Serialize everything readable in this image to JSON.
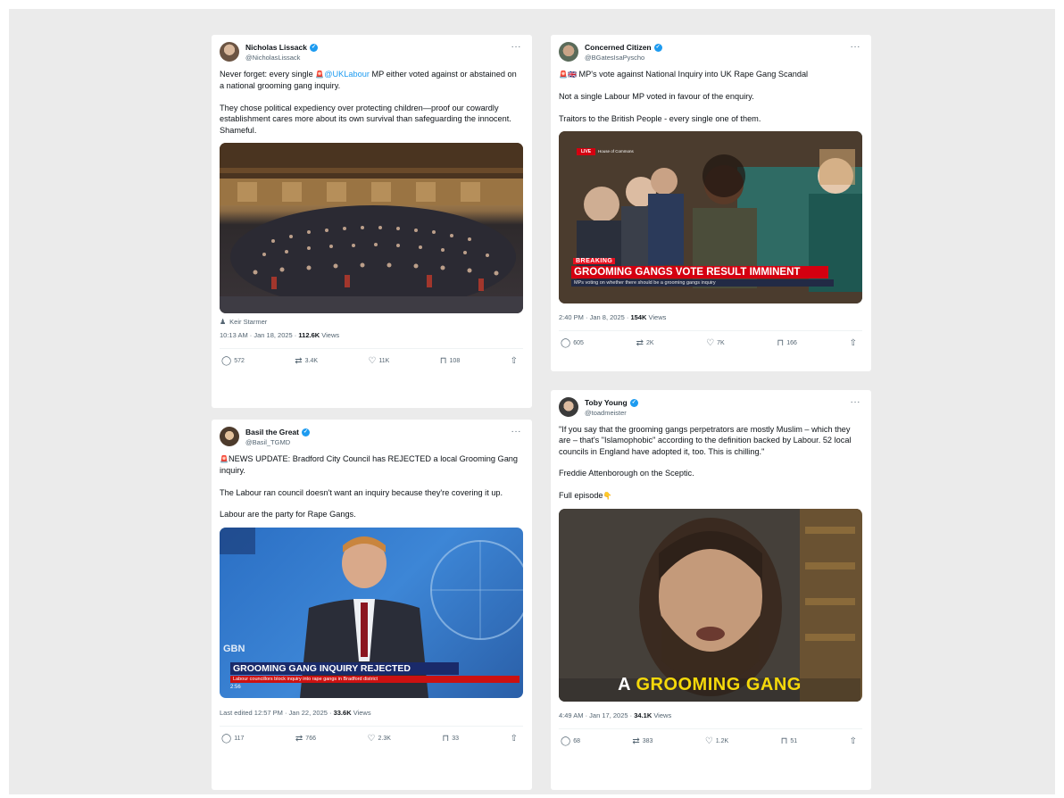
{
  "tweets": [
    {
      "name": "Nicholas Lissack",
      "handle": "@NicholasLissack",
      "body_parts": [
        "Never forget: every single ",
        "@UKLabour",
        " MP either voted against or abstained on a national grooming gang inquiry."
      ],
      "body2": "They chose political expediency over protecting children—proof our cowardly establishment cares more about its own survival than safeguarding the innocent. Shameful.",
      "attribution": "Keir Starmer",
      "time": "10:13 AM · Jan 18, 2025 · ",
      "views": "112.6K",
      "views_label": " Views",
      "replies": "572",
      "reposts": "3.4K",
      "likes": "11K",
      "bookmarks": "108"
    },
    {
      "name": "Concerned Citizen",
      "handle": "@BGatesIsaPyscho",
      "line1": "MP's vote against National Inquiry into UK Rape Gang Scandal",
      "line2": "Not a single Labour MP voted in favour of the enquiry.",
      "line3": "Traitors to the British People - every single one of them.",
      "banner_tag": "BREAKING",
      "banner_title": "GROOMING GANGS VOTE RESULT IMMINENT",
      "banner_sub": "MPs voting on whether there should be a grooming gangs inquiry",
      "live": "LIVE",
      "house": "House of Commons",
      "time": "2:40 PM · Jan 8, 2025 · ",
      "views": "154K",
      "views_label": " Views",
      "replies": "605",
      "reposts": "2K",
      "likes": "7K",
      "bookmarks": "166"
    },
    {
      "name": "Basil the Great",
      "handle": "@Basil_TGMD",
      "line1": "NEWS UPDATE: Bradford City Council has REJECTED  a local Grooming Gang inquiry.",
      "line2": "The Labour ran council doesn't want an inquiry because they're covering it up.",
      "line3": "Labour are the party for Rape Gangs.",
      "channel": "GBN",
      "banner_title": "GROOMING GANG INQUIRY REJECTED",
      "banner_sub": "Labour councillors block inquiry into rape gangs in Bradford district",
      "clock": "2:56",
      "time": "Last edited 12:57 PM · Jan 22, 2025 · ",
      "views": "33.6K",
      "views_label": " Views",
      "replies": "117",
      "reposts": "766",
      "likes": "2.3K",
      "bookmarks": "33"
    },
    {
      "name": "Toby Young",
      "handle": "@toadmeister",
      "line1": "\"If you say that the grooming gangs perpetrators are mostly Muslim – which they are – that's \"Islamophobic\" according to the definition backed by Labour. 52 local councils in England have adopted it, too. This is chilling.\"",
      "line2": "Freddie Attenborough on the Sceptic.",
      "line3": "Full episode",
      "caption_a": "A ",
      "caption_b": "GROOMING GANG",
      "time": "4:49 AM · Jan 17, 2025 · ",
      "views": "34.1K",
      "views_label": " Views",
      "replies": "68",
      "reposts": "383",
      "likes": "1.2K",
      "bookmarks": "51"
    }
  ],
  "icons": {
    "verified": "✓",
    "more": "···",
    "reply": "◯",
    "repost": "⇄",
    "like": "♡",
    "bookmark": "⊓",
    "share": "⇧",
    "person": "♟",
    "siren": "🚨",
    "flag": "🇬🇧",
    "point_down": "👇"
  },
  "colors": {
    "accent": "#1d9bf0",
    "canvas": "#ebebeb",
    "banner_red": "#d40010"
  }
}
